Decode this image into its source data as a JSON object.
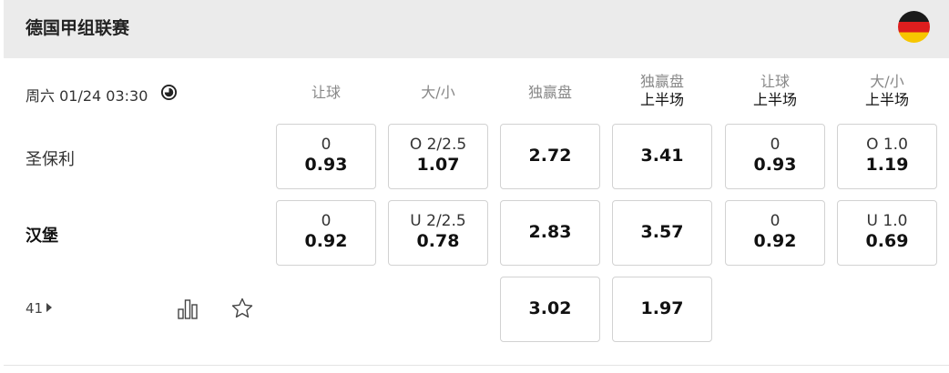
{
  "header": {
    "league": "德国甲组联赛",
    "flag": "germany-flag"
  },
  "match": {
    "datetime": "周六 01/24 03:30"
  },
  "columns": [
    {
      "label": "让球",
      "sub": ""
    },
    {
      "label": "大/小",
      "sub": ""
    },
    {
      "label": "独赢盘",
      "sub": ""
    },
    {
      "label": "独赢盘",
      "sub": "上半场"
    },
    {
      "label": "让球",
      "sub": "上半场"
    },
    {
      "label": "大/小",
      "sub": "上半场"
    }
  ],
  "teams": {
    "home": "圣保利",
    "away": "汉堡"
  },
  "odds": {
    "home": [
      {
        "line": "0",
        "price": "0.93"
      },
      {
        "line": "O 2/2.5",
        "price": "1.07"
      },
      {
        "line": "",
        "price": "2.72"
      },
      {
        "line": "",
        "price": "3.41"
      },
      {
        "line": "0",
        "price": "0.93"
      },
      {
        "line": "O 1.0",
        "price": "1.19"
      }
    ],
    "away": [
      {
        "line": "0",
        "price": "0.92"
      },
      {
        "line": "U 2/2.5",
        "price": "0.78"
      },
      {
        "line": "",
        "price": "2.83"
      },
      {
        "line": "",
        "price": "3.57"
      },
      {
        "line": "0",
        "price": "0.92"
      },
      {
        "line": "U 1.0",
        "price": "0.69"
      }
    ],
    "draw": [
      {
        "price": "3.02"
      },
      {
        "price": "1.97"
      }
    ]
  },
  "footer": {
    "more_count": "41"
  },
  "colors": {
    "header_bg": "#ebebeb",
    "border": "#d2d2d2"
  }
}
